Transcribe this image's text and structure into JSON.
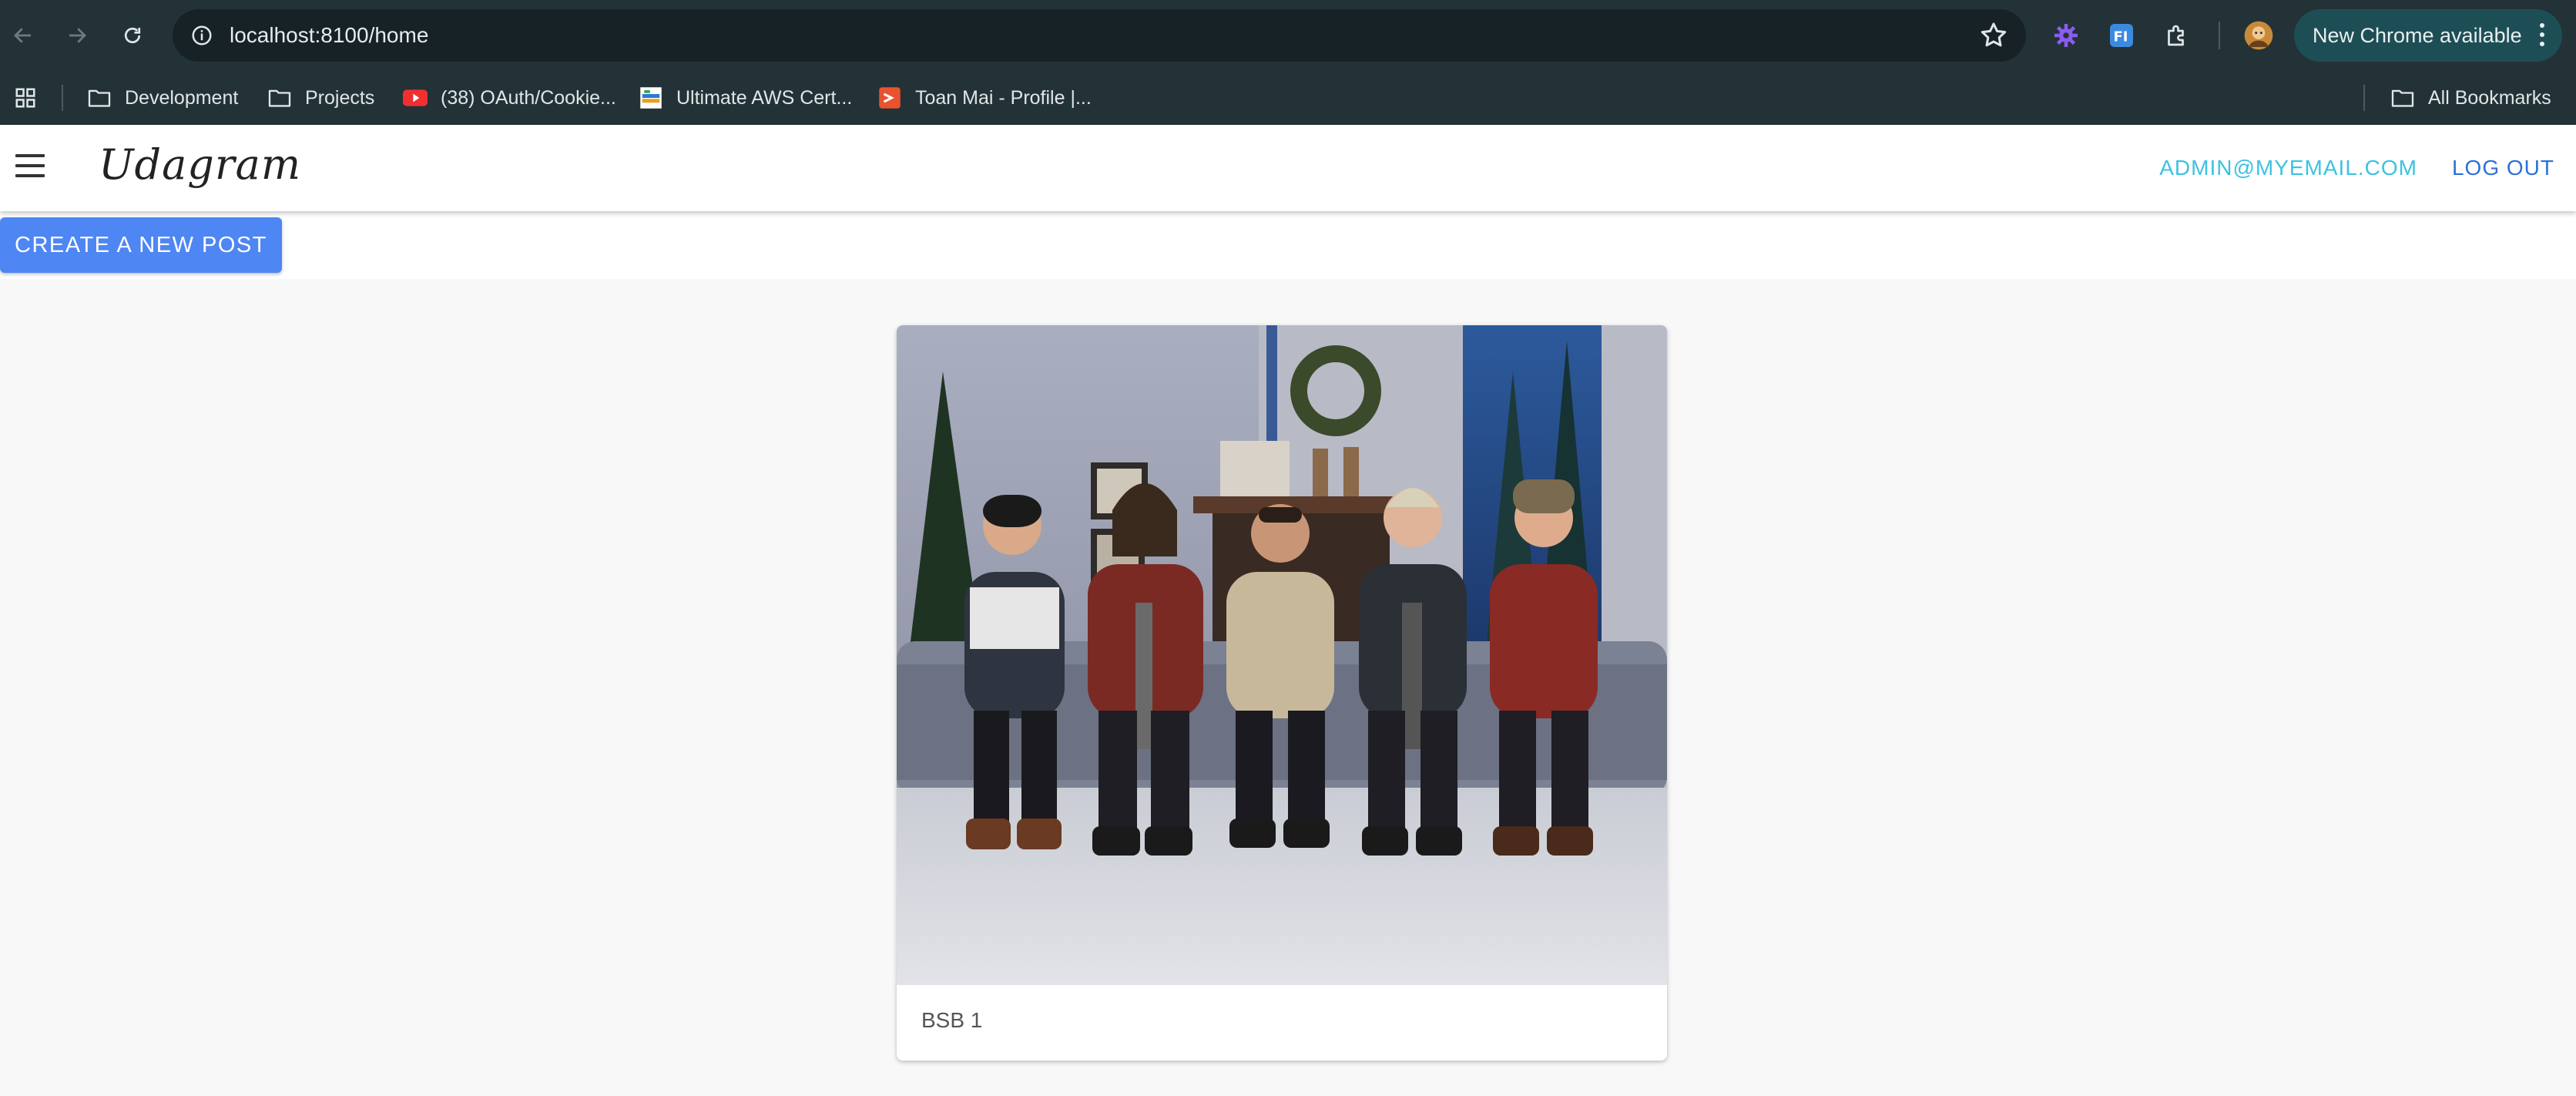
{
  "browser": {
    "url": "localhost:8100/home",
    "new_chrome_label": "New Chrome available"
  },
  "bookmarks": [
    {
      "label": "Development",
      "icon": "folder-icon"
    },
    {
      "label": "Projects",
      "icon": "folder-icon"
    },
    {
      "label": "(38) OAuth/Cookie...",
      "icon": "youtube-icon"
    },
    {
      "label": "Ultimate AWS Cert...",
      "icon": "site-favicon"
    },
    {
      "label": "Toan Mai - Profile |...",
      "icon": "speakerdeck-icon"
    }
  ],
  "all_bookmarks_label": "All Bookmarks",
  "app": {
    "brand": "Udagram",
    "user_email": "ADMIN@MYEMAIL.COM",
    "logout_label": "LOG OUT",
    "create_post_label": "CREATE A NEW POST"
  },
  "posts": [
    {
      "caption": "BSB 1"
    }
  ],
  "colors": {
    "chrome_bg": "#233236",
    "primary_button": "#4e86f4",
    "email_link": "#3dc2e0",
    "logout_link": "#2e6fd9"
  }
}
